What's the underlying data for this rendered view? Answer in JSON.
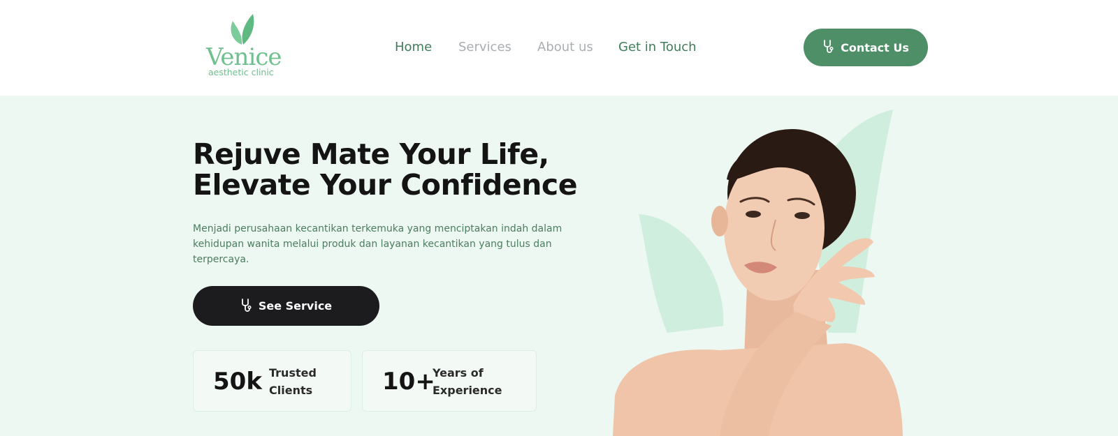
{
  "brand": {
    "name": "Venice",
    "tagline": "aesthetic clinic",
    "logo_icon": "leaf-icon",
    "color": "#6fc08f"
  },
  "nav": {
    "items": [
      {
        "label": "Home",
        "state": "active"
      },
      {
        "label": "Services",
        "state": "muted"
      },
      {
        "label": "About us",
        "state": "muted"
      },
      {
        "label": "Get in Touch",
        "state": "active"
      }
    ]
  },
  "header": {
    "contact_label": "Contact Us",
    "contact_icon": "stethoscope-icon"
  },
  "hero": {
    "title_line1": "Rejuve Mate Your Life,",
    "title_line2": "Elevate Your Confidence",
    "description": "Menjadi perusahaan kecantikan terkemuka yang menciptakan indah dalam kehidupan wanita melalui produk dan layanan kecantikan yang tulus dan terpercaya.",
    "cta_label": "See Service",
    "cta_icon": "stethoscope-icon"
  },
  "stats": [
    {
      "value": "50k",
      "label_line1": "Trusted",
      "label_line2": "Clients"
    },
    {
      "value": "10+",
      "label_line1": "Years of",
      "label_line2": "Experience"
    }
  ],
  "colors": {
    "primary": "#4f8f68",
    "hero_bg": "#ecf8f1",
    "dark_button": "#1c1c1e",
    "nav_muted": "#a9aeb0"
  }
}
